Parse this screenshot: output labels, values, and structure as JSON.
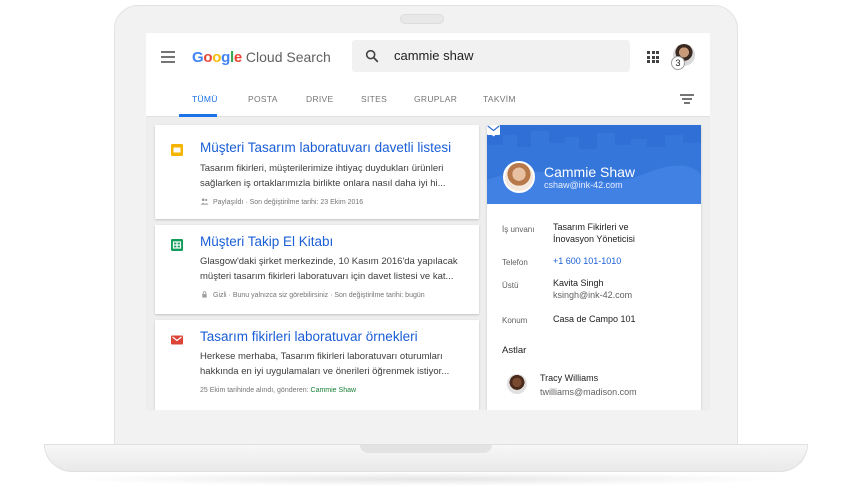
{
  "app": {
    "logo": {
      "letters": [
        "G",
        "o",
        "o",
        "g",
        "l",
        "e"
      ],
      "colors": [
        "#4285F4",
        "#EA4335",
        "#FBBC05",
        "#4285F4",
        "#34A853",
        "#EA4335"
      ],
      "product": "Cloud Search"
    },
    "search": {
      "query": "cammie shaw",
      "icon": "search-icon"
    },
    "account_badge": "3",
    "tabs": [
      "TÜMÜ",
      "POSTA",
      "DRIVE",
      "SITES",
      "GRUPLAR",
      "TAKVİM"
    ],
    "active_tab": "TÜMÜ"
  },
  "results": [
    {
      "type": "slides",
      "icon_color": "#F4B400",
      "title": "Müşteri Tasarım laboratuvarı davetli listesi",
      "snippet_line1": "Tasarım fikirleri, müşterilerimize ihtiyaç duydukları ürünleri",
      "snippet_line2": "sağlarken iş ortaklarımızla birlikte onlara nasıl daha iyi hi...",
      "meta": "Paylaşıldı · Son değiştirilme tarihi: 23 Ekim 2016",
      "meta_icon": "people-icon"
    },
    {
      "type": "sheets",
      "icon_color": "#0F9D58",
      "title": "Müşteri Takip El Kitabı",
      "snippet_line1": "Glasgow'daki şirket merkezinde, 10 Kasım 2016'da yapılacak",
      "snippet_line2": "müşteri tasarım fikirleri laboratuvarı için davet listesi ve kat...",
      "meta": "Gizli · Bunu yalnızca siz görebilirsiniz · Son değiştirilme tarihi: bugün",
      "meta_icon": "lock-icon"
    },
    {
      "type": "gmail",
      "icon_color": "#DB4437",
      "title": "Tasarım fikirleri laboratuvar örnekleri",
      "snippet_line1": "Herkese merhaba, Tasarım fikirleri laboratuvarı oturumları",
      "snippet_line2": "hakkında en iyi uygulamaları ve önerileri öğrenmek istiyor...",
      "meta": "25 Ekim tarihinde alındı, gönderen: ",
      "meta_sender": "Cammie Shaw"
    }
  ],
  "profile": {
    "name": "Cammie Shaw",
    "email": "cshaw@ink-42.com",
    "header_color": "#2F6FD6",
    "fields": {
      "job_label": "İş unvanı",
      "job_line1": "Tasarım Fikirleri ve",
      "job_line2": "İnovasyon Yöneticisi",
      "phone_label": "Telefon",
      "phone": "+1 600 101-1010",
      "manager_label": "Üstü",
      "manager_name": "Kavita Singh",
      "manager_email": "ksingh@ink-42.com",
      "location_label": "Konum",
      "location": "Casa de Campo 101"
    },
    "reports_label": "Astlar",
    "report": {
      "name": "Tracy Williams",
      "email": "twilliams@madison.com"
    }
  }
}
